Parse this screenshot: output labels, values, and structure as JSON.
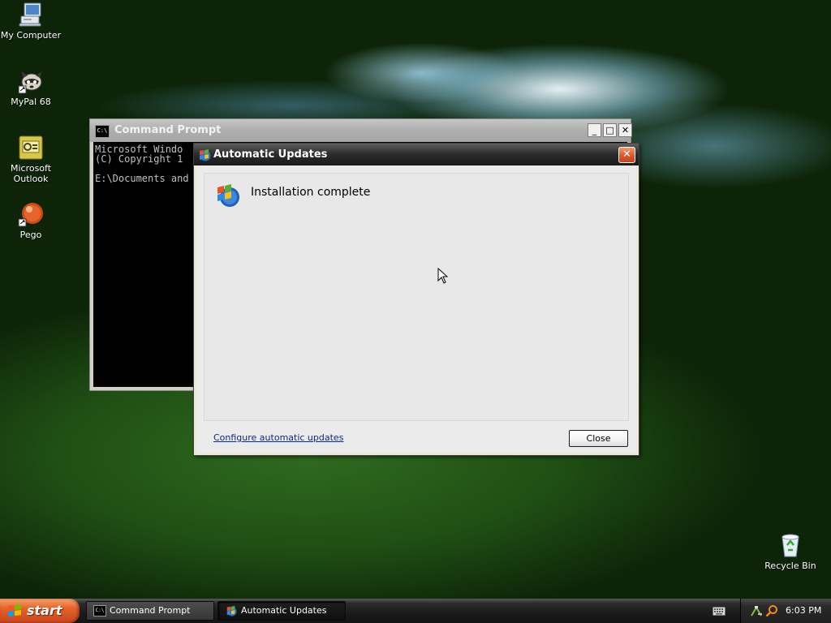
{
  "desktop": {
    "icons": [
      {
        "label": "My Computer",
        "icon": "my-computer-icon"
      },
      {
        "label": "MyPal 68",
        "icon": "mypal-browser-icon"
      },
      {
        "label": "Microsoft\nOutlook",
        "icon": "outlook-icon"
      },
      {
        "label": "Pego",
        "icon": "pego-icon"
      },
      {
        "label": "Recycle Bin",
        "icon": "recycle-bin-icon"
      }
    ]
  },
  "cmd_window": {
    "title": "Command Prompt",
    "console_text": "Microsoft Windo\n(C) Copyright 1\n\nE:\\Documents and"
  },
  "au_dialog": {
    "title": "Automatic Updates",
    "status": "Installation complete",
    "config_link": "Configure automatic updates",
    "close_button": "Close"
  },
  "taskbar": {
    "start_label": "start",
    "tasks": [
      {
        "label": "Command Prompt",
        "icon": "cmd-icon",
        "active": false
      },
      {
        "label": "Automatic Updates",
        "icon": "windows-update-icon",
        "active": true
      }
    ],
    "clock": "6:03 PM"
  },
  "colors": {
    "taskbar": "#1b1b1b",
    "start_button": "#e4622a",
    "dialog_title": "#2e2e2e",
    "link": "#0b2a8a"
  }
}
